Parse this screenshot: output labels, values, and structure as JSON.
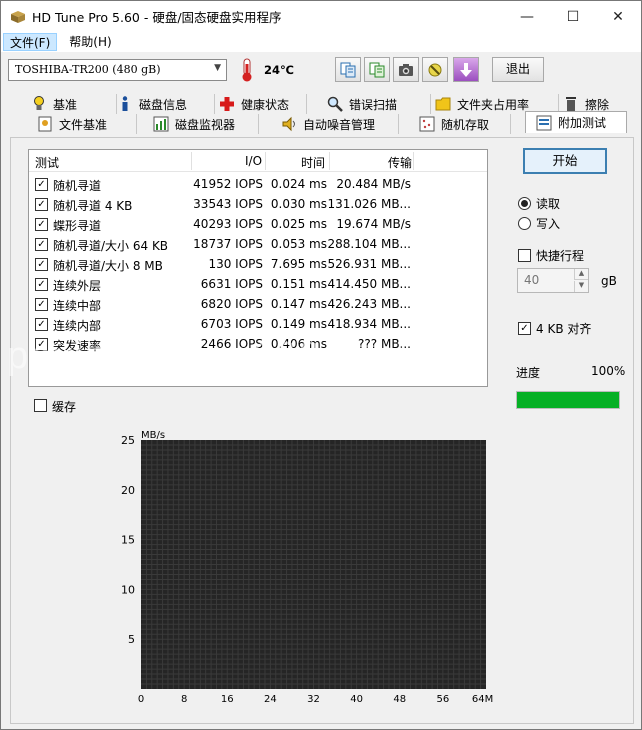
{
  "window": {
    "title": "HD Tune Pro 5.60 - 硬盘/固态硬盘实用程序",
    "minimize": "—",
    "maximize": "☐",
    "close": "✕"
  },
  "menu": {
    "file": "文件(F)",
    "help": "帮助(H)"
  },
  "toolbar": {
    "drive": "TOSHIBA-TR200 (480 gB)",
    "temperature": "24℃",
    "exit": "退出"
  },
  "tabs": {
    "row1": [
      "基准",
      "磁盘信息",
      "健康状态",
      "错误扫描",
      "文件夹占用率",
      "擦除"
    ],
    "row2": [
      "文件基准",
      "磁盘监视器",
      "自动噪音管理",
      "随机存取",
      "附加测试"
    ]
  },
  "results": {
    "headers": {
      "test": "测试",
      "io": "I/O",
      "time": "时间",
      "rate": "传输"
    },
    "rows": [
      {
        "name": "随机寻道",
        "io": "41952 IOPS",
        "time": "0.024 ms",
        "rate": "20.484 MB/s",
        "checked": true
      },
      {
        "name": "随机寻道 4 KB",
        "io": "33543 IOPS",
        "time": "0.030 ms",
        "rate": "131.026 MB...",
        "checked": true
      },
      {
        "name": "蝶形寻道",
        "io": "40293 IOPS",
        "time": "0.025 ms",
        "rate": "19.674 MB/s",
        "checked": true
      },
      {
        "name": "随机寻道/大小 64 KB",
        "io": "18737 IOPS",
        "time": "0.053 ms",
        "rate": "288.104 MB...",
        "checked": true
      },
      {
        "name": "随机寻道/大小 8 MB",
        "io": "130 IOPS",
        "time": "7.695 ms",
        "rate": "526.931 MB...",
        "checked": true
      },
      {
        "name": "连续外层",
        "io": "6631 IOPS",
        "time": "0.151 ms",
        "rate": "414.450 MB...",
        "checked": true
      },
      {
        "name": "连续中部",
        "io": "6820 IOPS",
        "time": "0.147 ms",
        "rate": "426.243 MB...",
        "checked": true
      },
      {
        "name": "连续内部",
        "io": "6703 IOPS",
        "time": "0.149 ms",
        "rate": "418.934 MB...",
        "checked": true
      },
      {
        "name": "突发速率",
        "io": "2466 IOPS",
        "time": "0.406 ms",
        "rate": "??? MB...",
        "checked": true
      }
    ]
  },
  "controls": {
    "start": "开始",
    "read": "读取",
    "write": "写入",
    "read_selected": true,
    "short_stroke": "快捷行程",
    "short_stroke_checked": false,
    "stroke_value": "40",
    "stroke_unit": "gB",
    "align_4kb": "4 KB 对齐",
    "align_4kb_checked": true,
    "progress_label": "进度",
    "progress_value": "100%",
    "progress_fraction": 1.0,
    "cache": "缓存",
    "cache_checked": false
  },
  "watermark": "payinnrjjq.....168.com",
  "chart_data": {
    "type": "line",
    "ylabel": "MB/s",
    "ylim": [
      0,
      25
    ],
    "yticks": [
      "25",
      "20",
      "15",
      "10",
      "5"
    ],
    "xlim": [
      0,
      64
    ],
    "xticks": [
      "0",
      "8",
      "16",
      "24",
      "32",
      "40",
      "48",
      "56",
      "64MB"
    ],
    "series": [],
    "grid": true
  }
}
